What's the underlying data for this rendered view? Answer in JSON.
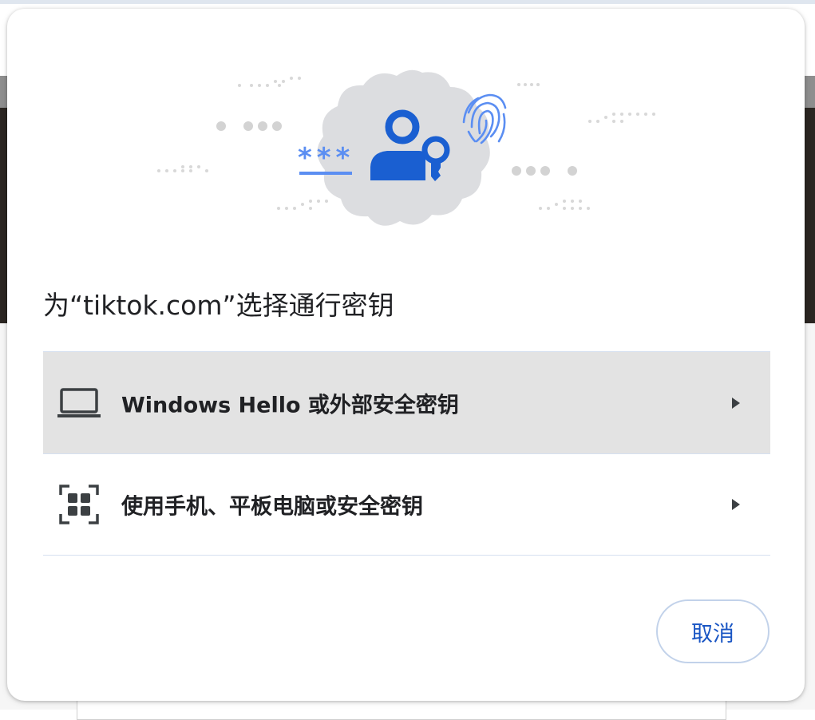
{
  "dialog": {
    "title": "为“tiktok.com”选择通行密钥",
    "options": [
      {
        "label": "Windows Hello 或外部安全密钥",
        "icon": "laptop-icon",
        "selected": true
      },
      {
        "label": "使用手机、平板电脑或安全密钥",
        "icon": "qr-code-icon",
        "selected": false
      }
    ],
    "cancel_label": "取消",
    "hero_password_mask": "***"
  },
  "colors": {
    "accent": "#1a56c4",
    "hero_blue": "#1a5fd1",
    "hero_light_blue": "#5b8ef2",
    "badge_bg": "#dcdde0",
    "selected_row_bg": "#e3e3e3",
    "divider": "#d5e0f0"
  }
}
